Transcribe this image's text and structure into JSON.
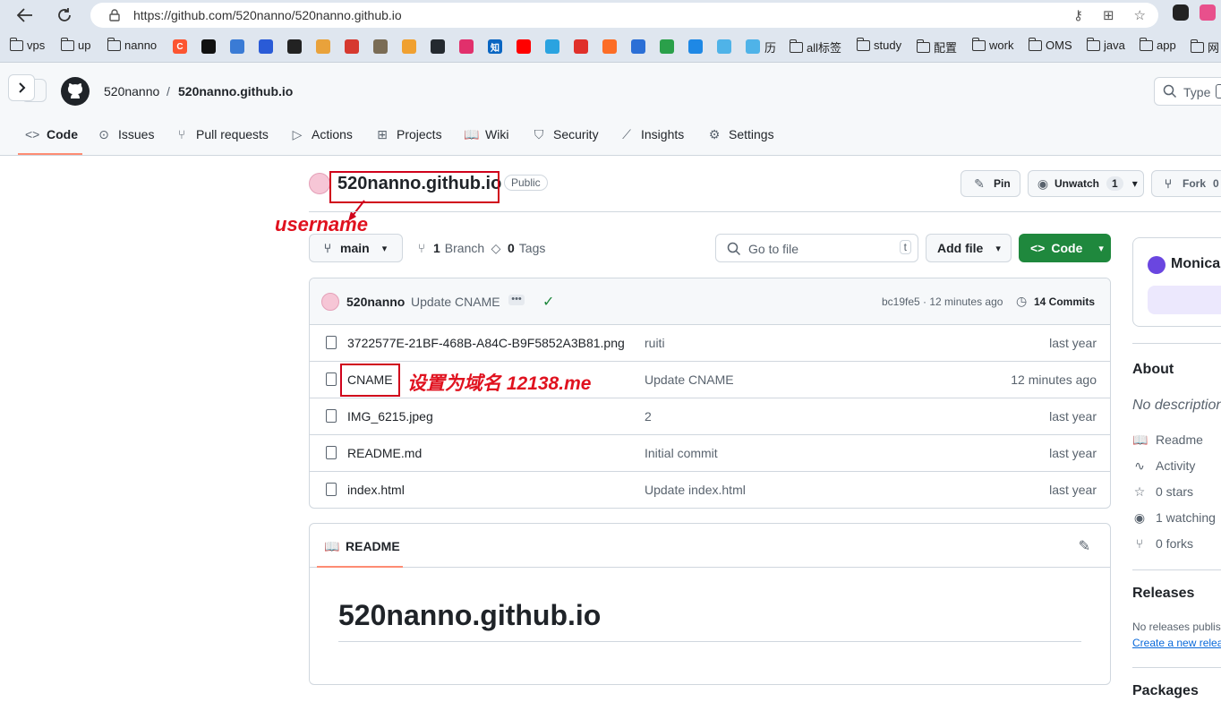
{
  "browser": {
    "url": "https://github.com/520nanno/520nanno.github.io",
    "bookmarks": [
      {
        "label": "vps",
        "type": "folder"
      },
      {
        "label": "up",
        "type": "folder"
      },
      {
        "label": "nanno",
        "type": "folder"
      },
      {
        "label": "历",
        "type": "text"
      },
      {
        "label": "all标签",
        "type": "folder"
      },
      {
        "label": "study",
        "type": "folder"
      },
      {
        "label": "配置",
        "type": "folder"
      },
      {
        "label": "work",
        "type": "folder"
      },
      {
        "label": "OMS",
        "type": "folder"
      },
      {
        "label": "java",
        "type": "folder"
      },
      {
        "label": "app",
        "type": "folder"
      },
      {
        "label": "网",
        "type": "folder"
      }
    ],
    "favicons": [
      {
        "icon": "C",
        "color": "#fc5531"
      },
      {
        "icon": "",
        "color": "#111111"
      },
      {
        "icon": "",
        "color": "#3a7bd5"
      },
      {
        "icon": "",
        "color": "#2a5bd7"
      },
      {
        "icon": "",
        "color": "#222222"
      },
      {
        "icon": "",
        "color": "#e9a23b"
      },
      {
        "icon": "",
        "color": "#d6392f"
      },
      {
        "icon": "",
        "color": "#7a6c55"
      },
      {
        "icon": "",
        "color": "#f0a030"
      },
      {
        "icon": "",
        "color": "#24292f"
      },
      {
        "icon": "",
        "color": "#e1306c"
      },
      {
        "icon": "知",
        "color": "#0a66c2"
      },
      {
        "icon": "",
        "color": "#ff0000"
      },
      {
        "icon": "",
        "color": "#2aa3e0"
      },
      {
        "icon": "",
        "color": "#e0302a"
      },
      {
        "icon": "",
        "color": "#fc6d26"
      },
      {
        "icon": "",
        "color": "#2b6fd6"
      },
      {
        "icon": "",
        "color": "#2aa04a"
      },
      {
        "icon": "",
        "color": "#1e88e5"
      },
      {
        "icon": "",
        "color": "#4fb3e8"
      },
      {
        "icon": "",
        "color": "#4fb3e8"
      }
    ]
  },
  "gh": {
    "owner": "520nanno",
    "sep": "/",
    "repo": "520nanno.github.io",
    "search_placeholder": "Type",
    "tabs": [
      "Code",
      "Issues",
      "Pull requests",
      "Actions",
      "Projects",
      "Wiki",
      "Security",
      "Insights",
      "Settings"
    ],
    "visibility": "Public",
    "pin": "Pin",
    "unwatch": "Unwatch",
    "watch_count": "1",
    "fork": "Fork",
    "fork_count": "0",
    "branch": "main",
    "branch_count": "1",
    "branch_label": "Branch",
    "tag_count": "0",
    "tag_label": "Tags",
    "goto_placeholder": "Go to file",
    "goto_key": "t",
    "add_file": "Add file",
    "code_btn": "Code",
    "commit": {
      "author": "520nanno",
      "message": "Update CNAME",
      "hash_time": "bc19fe5 · 12 minutes ago",
      "commits": "14 Commits"
    },
    "files": [
      {
        "name": "3722577E-21BF-468B-A84C-B9F5852A3B81.png",
        "message": "ruiti",
        "date": "last year"
      },
      {
        "name": "CNAME",
        "message": "Update CNAME",
        "date": "12 minutes ago"
      },
      {
        "name": "IMG_6215.jpeg",
        "message": "2",
        "date": "last year"
      },
      {
        "name": "README.md",
        "message": "Initial commit",
        "date": "last year"
      },
      {
        "name": "index.html",
        "message": "Update index.html",
        "date": "last year"
      }
    ],
    "readme_tab": "README",
    "readme_heading": "520nanno.github.io"
  },
  "annotations": {
    "username": "username",
    "cname_note": "设置为域名 12138.me",
    "color": "#d0021b"
  },
  "sidebar": {
    "monica": "Monica",
    "about": "About",
    "no_desc": "No description",
    "items": [
      "Readme",
      "Activity",
      "0 stars",
      "1 watching",
      "0 forks"
    ],
    "releases": "Releases",
    "no_releases": "No releases publish",
    "create_release": "Create a new releas",
    "packages": "Packages"
  },
  "colors": {
    "accent_green": "#1f883d",
    "tab_underline": "#fd8c73",
    "link_blue": "#0969da"
  }
}
